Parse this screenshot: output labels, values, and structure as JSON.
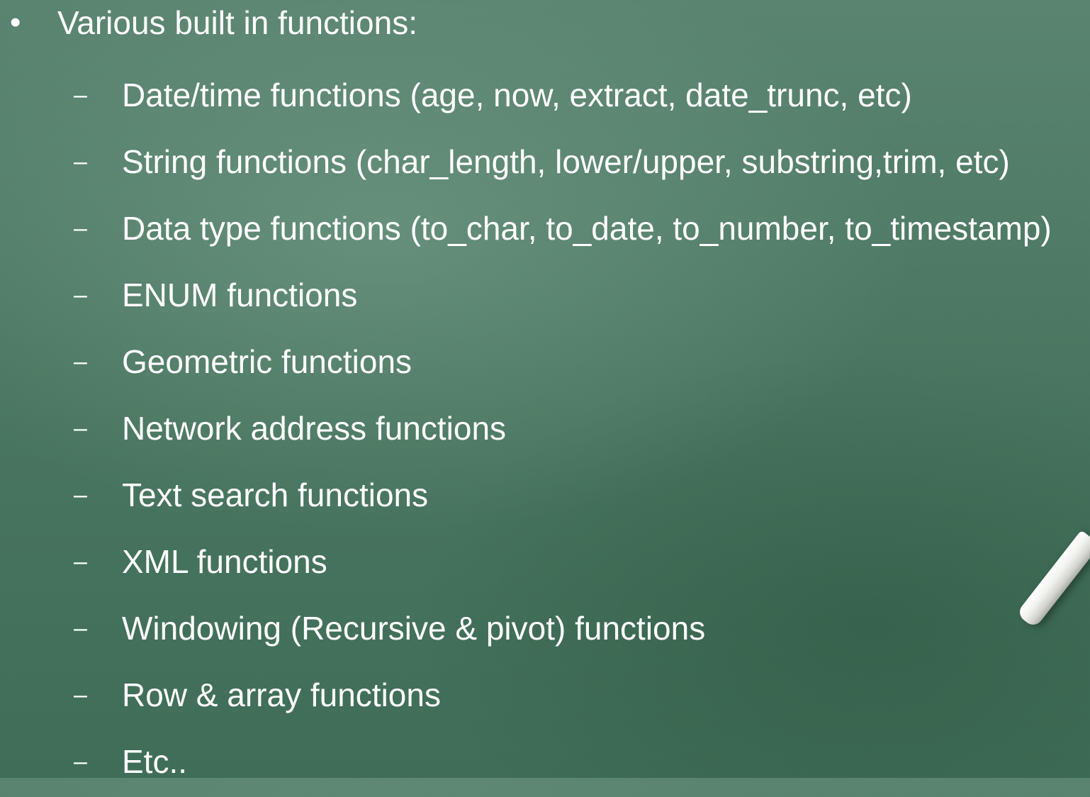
{
  "slide": {
    "bullet": "•",
    "heading": "Various built in functions:",
    "dash": "–",
    "items": [
      "Date/time functions (age, now, extract, date_trunc, etc)",
      "String functions (char_length, lower/upper, substring,trim, etc)",
      "Data type functions (to_char, to_date, to_number, to_timestamp)",
      "ENUM functions",
      "Geometric functions",
      "Network address functions",
      "Text search functions",
      "XML functions",
      "Windowing (Recursive & pivot) functions",
      "Row & array functions",
      "Etc.."
    ]
  },
  "colors": {
    "chalkboard": "#46725d",
    "text": "#ffffff"
  }
}
